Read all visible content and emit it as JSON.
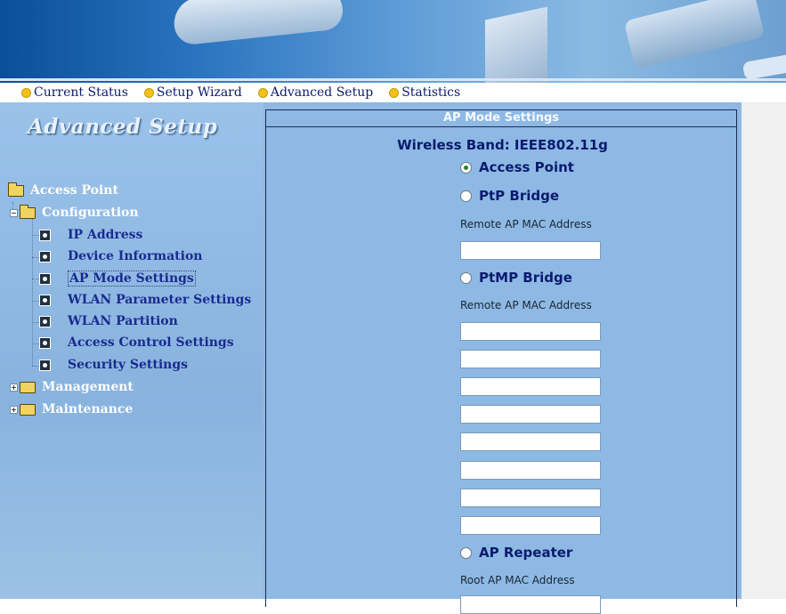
{
  "nav": {
    "items": [
      {
        "label": "Current Status"
      },
      {
        "label": "Setup Wizard"
      },
      {
        "label": "Advanced Setup"
      },
      {
        "label": "Statistics"
      }
    ]
  },
  "sidebar": {
    "title": "Advanced Setup",
    "tree": {
      "root": "Access Point",
      "configuration": "Configuration",
      "items": [
        {
          "label": "IP Address"
        },
        {
          "label": "Device Information"
        },
        {
          "label": "AP Mode Settings"
        },
        {
          "label": "WLAN Parameter Settings"
        },
        {
          "label": "WLAN Partition"
        },
        {
          "label": "Access Control Settings"
        },
        {
          "label": "Security Settings"
        }
      ],
      "management": "Management",
      "maintenance": "Maintenance"
    }
  },
  "panel": {
    "header": "AP Mode Settings",
    "band": "Wireless Band: IEEE802.11g",
    "modes": {
      "access_point": "Access Point",
      "ptp": "PtP Bridge",
      "ptmp": "PtMP Bridge",
      "repeater": "AP Repeater"
    },
    "selected_mode": "Access Point",
    "remote_label": "Remote AP MAC Address",
    "root_label": "Root AP MAC Address",
    "ptp_mac": "",
    "ptmp_macs": [
      "",
      "",
      "",
      "",
      "",
      "",
      "",
      ""
    ],
    "root_mac": ""
  }
}
